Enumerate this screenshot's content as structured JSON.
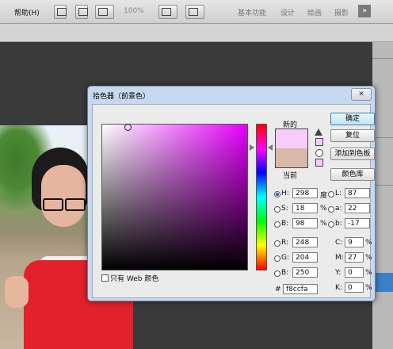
{
  "menubar": {
    "help_label": "帮助(H)",
    "zoom_label": "100%",
    "workspaces": [
      "基本功能",
      "设计",
      "绘画",
      "摄影"
    ],
    "more_label": "»"
  },
  "dialog": {
    "title": "拾色器（前景色）",
    "close_label": "✕",
    "new_label": "新的",
    "current_label": "当前",
    "new_color": "#f8ccfa",
    "current_color": "#d8b8a8",
    "buttons": {
      "ok": "确定",
      "reset": "复位",
      "add_to_swatches": "添加到色板",
      "color_libraries": "颜色库"
    },
    "web_only_label": "只有 Web 颜色",
    "hsb": {
      "h_label": "H:",
      "h_value": "298",
      "h_unit": "度",
      "s_label": "S:",
      "s_value": "18",
      "s_unit": "%",
      "b_label": "B:",
      "b_value": "98",
      "b_unit": "%"
    },
    "rgb": {
      "r_label": "R:",
      "r_value": "248",
      "g_label": "G:",
      "g_value": "204",
      "b_label": "B:",
      "b_value": "250"
    },
    "lab": {
      "l_label": "L:",
      "l_value": "87",
      "a_label": "a:",
      "a_value": "22",
      "b_label": "b:",
      "b_value": "-17"
    },
    "cmyk": {
      "c_label": "C:",
      "c_value": "9",
      "c_unit": "%",
      "m_label": "M:",
      "m_value": "27",
      "m_unit": "%",
      "y_label": "Y:",
      "y_value": "0",
      "y_unit": "%",
      "k_label": "K:",
      "k_value": "0",
      "k_unit": "%"
    },
    "hex_label": "#",
    "hex_value": "f8ccfa"
  }
}
